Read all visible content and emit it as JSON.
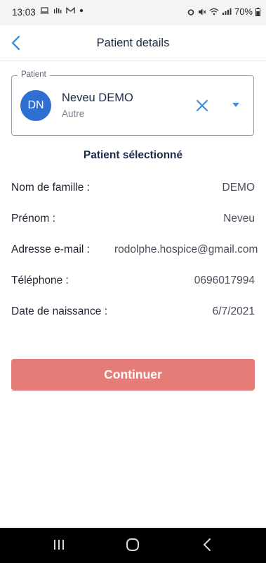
{
  "status_bar": {
    "time": "13:03",
    "battery": "70%",
    "left_icons": [
      "laptop-icon",
      "signal-alt-icon",
      "gmail-icon",
      "dot-icon"
    ],
    "right_icons": [
      "alarm-icon",
      "mute-icon",
      "wifi-icon",
      "cell-signal-icon",
      "battery-icon"
    ]
  },
  "header": {
    "title": "Patient details"
  },
  "patient": {
    "legend": "Patient",
    "initials": "DN",
    "name": "Neveu DEMO",
    "subtitle": "Autre"
  },
  "section_title": "Patient sélectionné",
  "details": [
    {
      "label": "Nom de famille :",
      "value": "DEMO"
    },
    {
      "label": "Prénom :",
      "value": "Neveu"
    },
    {
      "label": "Adresse e-mail :",
      "value": "rodolphe.hospice@gmail.com"
    },
    {
      "label": "Téléphone :",
      "value": "0696017994"
    },
    {
      "label": "Date de naissance :",
      "value": "6/7/2021"
    }
  ],
  "continue_label": "Continuer",
  "colors": {
    "accent": "#2f6fd2",
    "avatar_bg": "#2f6fd2",
    "button_bg": "#e57c78",
    "icon_blue": "#3b8fe0"
  }
}
